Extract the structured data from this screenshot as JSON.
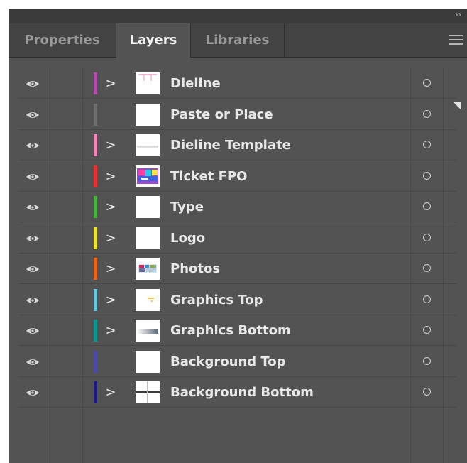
{
  "panel": {
    "collapse_glyph": "››",
    "tabs": [
      {
        "label": "Properties",
        "active": false
      },
      {
        "label": "Layers",
        "active": true
      },
      {
        "label": "Libraries",
        "active": false
      }
    ],
    "menu_icon": "hamburger-menu-icon"
  },
  "layers": [
    {
      "name": "Dieline",
      "color": "#b04fa8",
      "expandable": true,
      "thumbnail": "dieline-thumbnail"
    },
    {
      "name": "Paste or Place",
      "color": "#6e6e6e",
      "expandable": false,
      "thumbnail": "blank-thumbnail"
    },
    {
      "name": "Dieline Template",
      "color": "#ee88b8",
      "expandable": true,
      "thumbnail": "dieline-template-thumbnail"
    },
    {
      "name": "Ticket FPO",
      "color": "#e23434",
      "expandable": true,
      "thumbnail": "ticket-thumbnail"
    },
    {
      "name": "Type",
      "color": "#4fb043",
      "expandable": true,
      "thumbnail": "blank-thumbnail"
    },
    {
      "name": "Logo",
      "color": "#e8e23a",
      "expandable": true,
      "thumbnail": "blank-thumbnail"
    },
    {
      "name": "Photos",
      "color": "#e66722",
      "expandable": true,
      "thumbnail": "photos-thumbnail"
    },
    {
      "name": "Graphics Top",
      "color": "#6fc6d9",
      "expandable": true,
      "thumbnail": "graphics-top-thumbnail"
    },
    {
      "name": "Graphics Bottom",
      "color": "#11948e",
      "expandable": true,
      "thumbnail": "graphics-bottom-thumbnail"
    },
    {
      "name": "Background Top",
      "color": "#4b4ba5",
      "expandable": false,
      "thumbnail": "blank-thumbnail"
    },
    {
      "name": "Background Bottom",
      "color": "#1c1c74",
      "expandable": true,
      "thumbnail": "background-bottom-thumbnail"
    }
  ],
  "chevron_glyph": ">"
}
